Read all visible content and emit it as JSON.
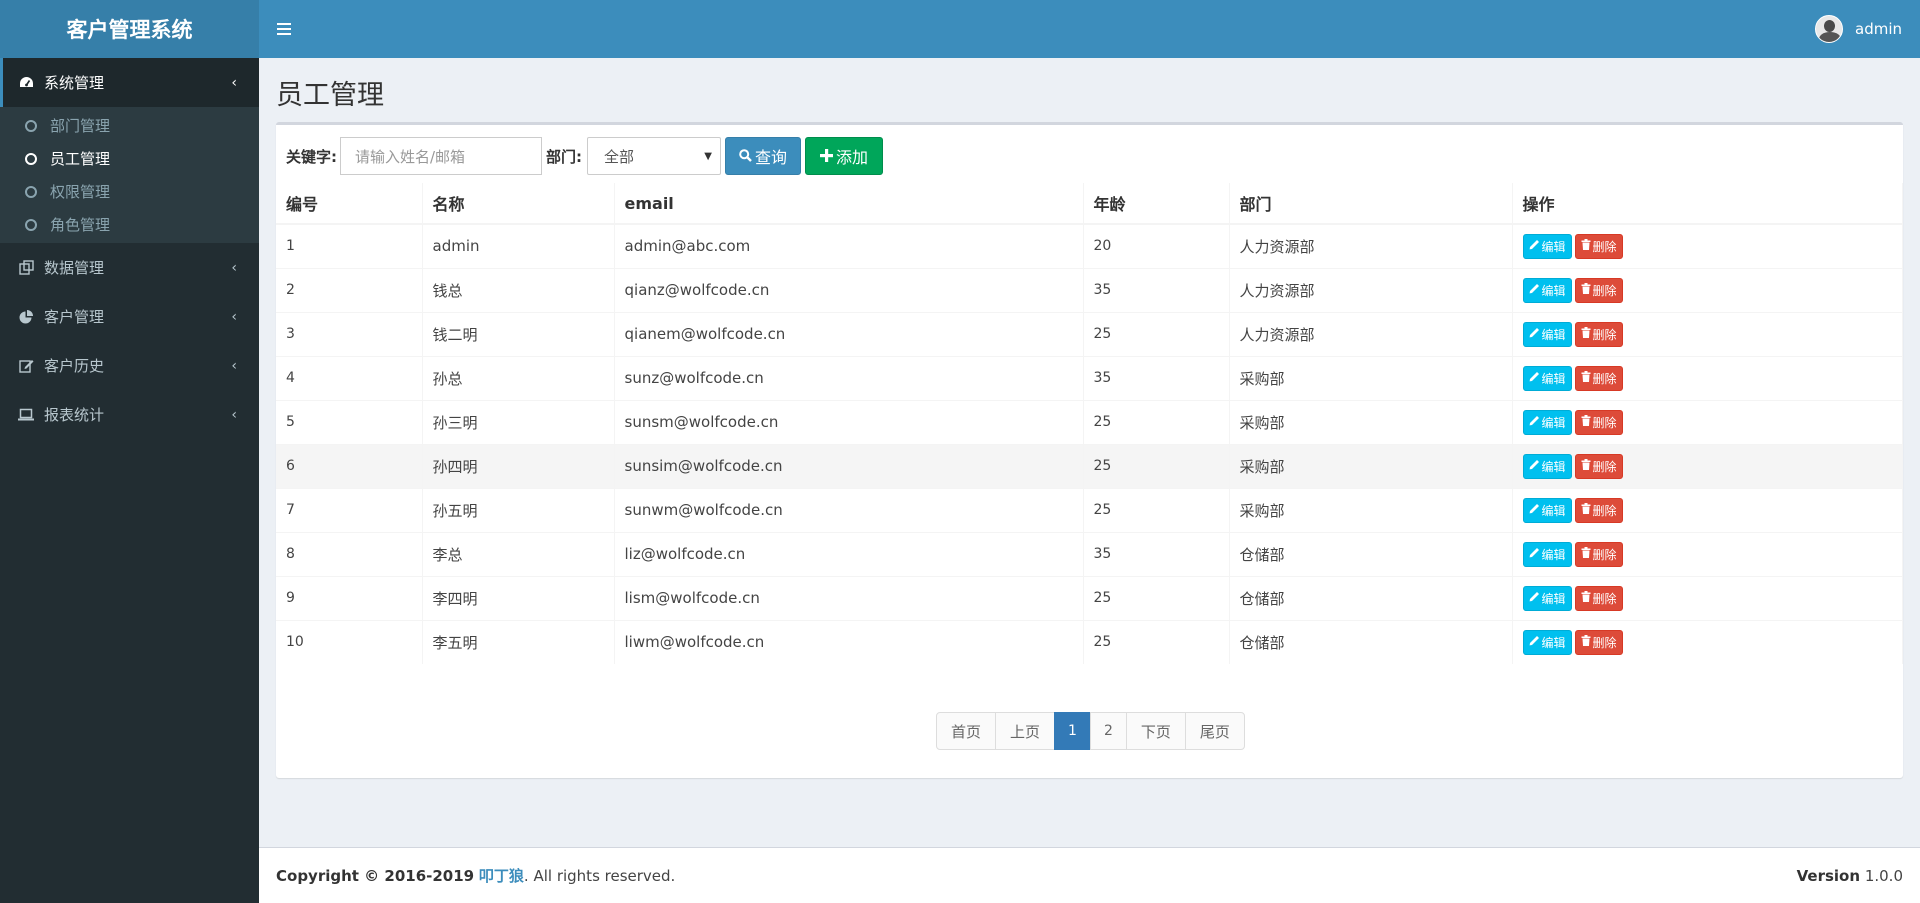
{
  "header": {
    "logo": "客户管理系统",
    "username": "admin"
  },
  "sidebar": {
    "sections": [
      {
        "label": "系统管理",
        "chevron": "‹",
        "active": true
      },
      {
        "label": "数据管理",
        "chevron": "‹"
      },
      {
        "label": "客户管理",
        "chevron": "‹"
      },
      {
        "label": "客户历史",
        "chevron": "‹"
      },
      {
        "label": "报表统计",
        "chevron": "‹"
      }
    ],
    "submenu": [
      {
        "label": "部门管理"
      },
      {
        "label": "员工管理",
        "active": true
      },
      {
        "label": "权限管理"
      },
      {
        "label": "角色管理"
      }
    ]
  },
  "page": {
    "title": "员工管理"
  },
  "filter": {
    "keyword_label": "关键字:",
    "keyword_placeholder": "请输入姓名/邮箱",
    "dept_label": "部门:",
    "dept_selected": "全部",
    "query_label": "查询",
    "add_label": "添加"
  },
  "table": {
    "headers": [
      "编号",
      "名称",
      "email",
      "年龄",
      "部门",
      "操作"
    ],
    "edit_label": "编辑",
    "delete_label": "删除",
    "rows": [
      {
        "id": "1",
        "name": "admin",
        "email": "admin@abc.com",
        "age": "20",
        "dept": "人力资源部"
      },
      {
        "id": "2",
        "name": "钱总",
        "email": "qianz@wolfcode.cn",
        "age": "35",
        "dept": "人力资源部"
      },
      {
        "id": "3",
        "name": "钱二明",
        "email": "qianem@wolfcode.cn",
        "age": "25",
        "dept": "人力资源部"
      },
      {
        "id": "4",
        "name": "孙总",
        "email": "sunz@wolfcode.cn",
        "age": "35",
        "dept": "采购部"
      },
      {
        "id": "5",
        "name": "孙三明",
        "email": "sunsm@wolfcode.cn",
        "age": "25",
        "dept": "采购部"
      },
      {
        "id": "6",
        "name": "孙四明",
        "email": "sunsim@wolfcode.cn",
        "age": "25",
        "dept": "采购部"
      },
      {
        "id": "7",
        "name": "孙五明",
        "email": "sunwm@wolfcode.cn",
        "age": "25",
        "dept": "采购部"
      },
      {
        "id": "8",
        "name": "李总",
        "email": "liz@wolfcode.cn",
        "age": "35",
        "dept": "仓储部"
      },
      {
        "id": "9",
        "name": "李四明",
        "email": "lism@wolfcode.cn",
        "age": "25",
        "dept": "仓储部"
      },
      {
        "id": "10",
        "name": "李五明",
        "email": "liwm@wolfcode.cn",
        "age": "25",
        "dept": "仓储部"
      }
    ]
  },
  "pagination": {
    "first": "首页",
    "prev": "上页",
    "pages": [
      "1",
      "2"
    ],
    "current": "1",
    "next": "下页",
    "last": "尾页"
  },
  "footer": {
    "copyright": "Copyright © 2016-2019",
    "brand": "叩丁狼",
    "rights": ". All rights reserved.",
    "version_label": "Version",
    "version": "1.0.0"
  },
  "colors": {
    "header": "#3c8dbc",
    "logo_bg": "#367fa9",
    "sidebar": "#222d32",
    "edit": "#00c0ef",
    "delete": "#dd4b39",
    "add": "#00a65a"
  },
  "icons": {
    "menu_toggle": "hamburger-icon",
    "sections": [
      "dashboard-icon",
      "data-icon",
      "pie-chart-icon",
      "edit-square-icon",
      "laptop-icon"
    ],
    "query": "search-icon",
    "add": "plus-icon",
    "edit": "pencil-icon",
    "delete": "trash-icon"
  }
}
